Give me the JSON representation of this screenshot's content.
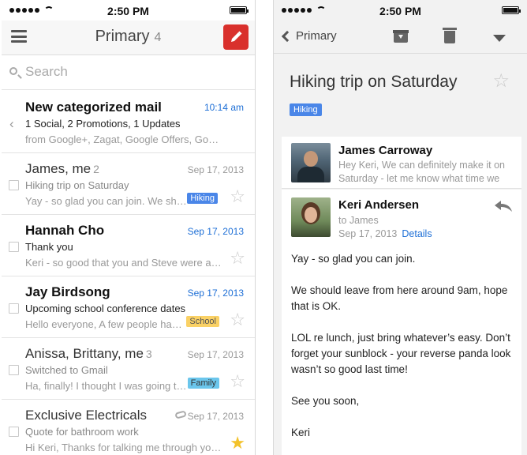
{
  "status": {
    "time": "2:50 PM"
  },
  "left": {
    "header": {
      "title": "Primary",
      "count": "4"
    },
    "search": {
      "placeholder": "Search"
    },
    "mails": [
      {
        "sender": "New categorized mail",
        "count": "",
        "date": "10:14 am",
        "subject": "1 Social, 2 Promotions, 1 Updates",
        "snippet": "from Google+, Zagat, Google Offers, Goo…",
        "label": "",
        "starred": false,
        "unread": true
      },
      {
        "sender": "James, me",
        "count": "2",
        "date": "Sep 17, 2013",
        "subject": "Hiking trip on Saturday",
        "snippet": "Yay - so glad you can join. We sho…",
        "label": "Hiking",
        "starred": false,
        "unread": false
      },
      {
        "sender": "Hannah Cho",
        "count": "",
        "date": "Sep 17, 2013",
        "subject": "Thank you",
        "snippet": "Keri - so good that you and Steve were ab…",
        "label": "",
        "starred": false,
        "unread": true
      },
      {
        "sender": "Jay Birdsong",
        "count": "",
        "date": "Sep 17, 2013",
        "subject": "Upcoming school conference dates",
        "snippet": "Hello everyone, A few people hav…",
        "label": "School",
        "starred": false,
        "unread": true
      },
      {
        "sender": "Anissa, Brittany, me",
        "count": "3",
        "date": "Sep 17, 2013",
        "subject": "Switched to Gmail",
        "snippet": "Ha, finally! I thought I was going to…",
        "label": "Family",
        "starred": false,
        "unread": false
      },
      {
        "sender": "Exclusive Electricals",
        "count": "",
        "date": "Sep 17, 2013",
        "subject": "Quote for bathroom work",
        "snippet": "Hi Keri, Thanks for talking me through your c…",
        "label": "",
        "starred": true,
        "unread": false
      }
    ]
  },
  "right": {
    "header": {
      "back_label": "Primary"
    },
    "thread": {
      "subject": "Hiking trip on Saturday",
      "label": "Hiking"
    },
    "collapsed": {
      "sender": "James Carroway",
      "snippet": "Hey Keri, We can definitely make it on Saturday - let me know what time we"
    },
    "expanded": {
      "sender": "Keri Andersen",
      "to": "to James",
      "date": "Sep 17, 2013",
      "details": "Details",
      "body": [
        "Yay - so glad you can join.",
        "We should leave from here around 9am, hope that is OK.",
        "LOL re lunch, just bring whatever’s easy. Don’t forget your sunblock - your reverse panda look wasn’t so good last time!",
        "See you soon,",
        "Keri"
      ]
    }
  },
  "colors": {
    "compose": "#d9302c",
    "link_blue": "#1e6fd6",
    "label_hiking_bg": "#4a86e8",
    "label_school_bg": "#fad165",
    "label_family_bg": "#6bc6ec",
    "star_on": "#f3c22b"
  }
}
